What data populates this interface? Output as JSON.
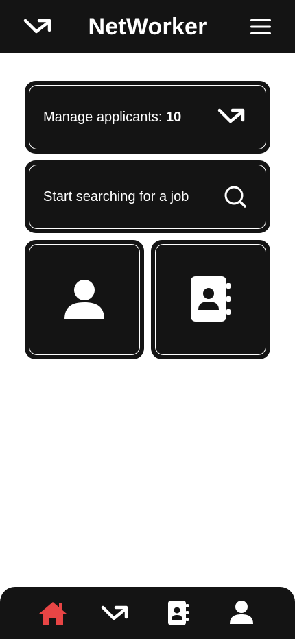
{
  "header": {
    "title": "NetWorker",
    "logo_icon": "trend-arrow-icon",
    "menu_icon": "hamburger-menu-icon"
  },
  "cards": {
    "applicants": {
      "label": "Manage applicants: ",
      "count": "10",
      "icon": "trend-arrow-icon"
    },
    "search": {
      "label": "Start searching for a job",
      "icon": "search-icon"
    },
    "profile": {
      "icon": "user-icon"
    },
    "contacts": {
      "icon": "address-book-icon"
    }
  },
  "bottom_nav": {
    "items": [
      {
        "name": "home",
        "icon": "home-icon",
        "active": true
      },
      {
        "name": "applicants",
        "icon": "trend-arrow-icon",
        "active": false
      },
      {
        "name": "contacts",
        "icon": "address-book-icon",
        "active": false
      },
      {
        "name": "profile",
        "icon": "user-icon",
        "active": false
      }
    ]
  },
  "colors": {
    "bar_background": "#141414",
    "card_background": "#141414",
    "foreground": "#ffffff",
    "active_accent": "#e84545",
    "page_background": "#ffffff"
  }
}
